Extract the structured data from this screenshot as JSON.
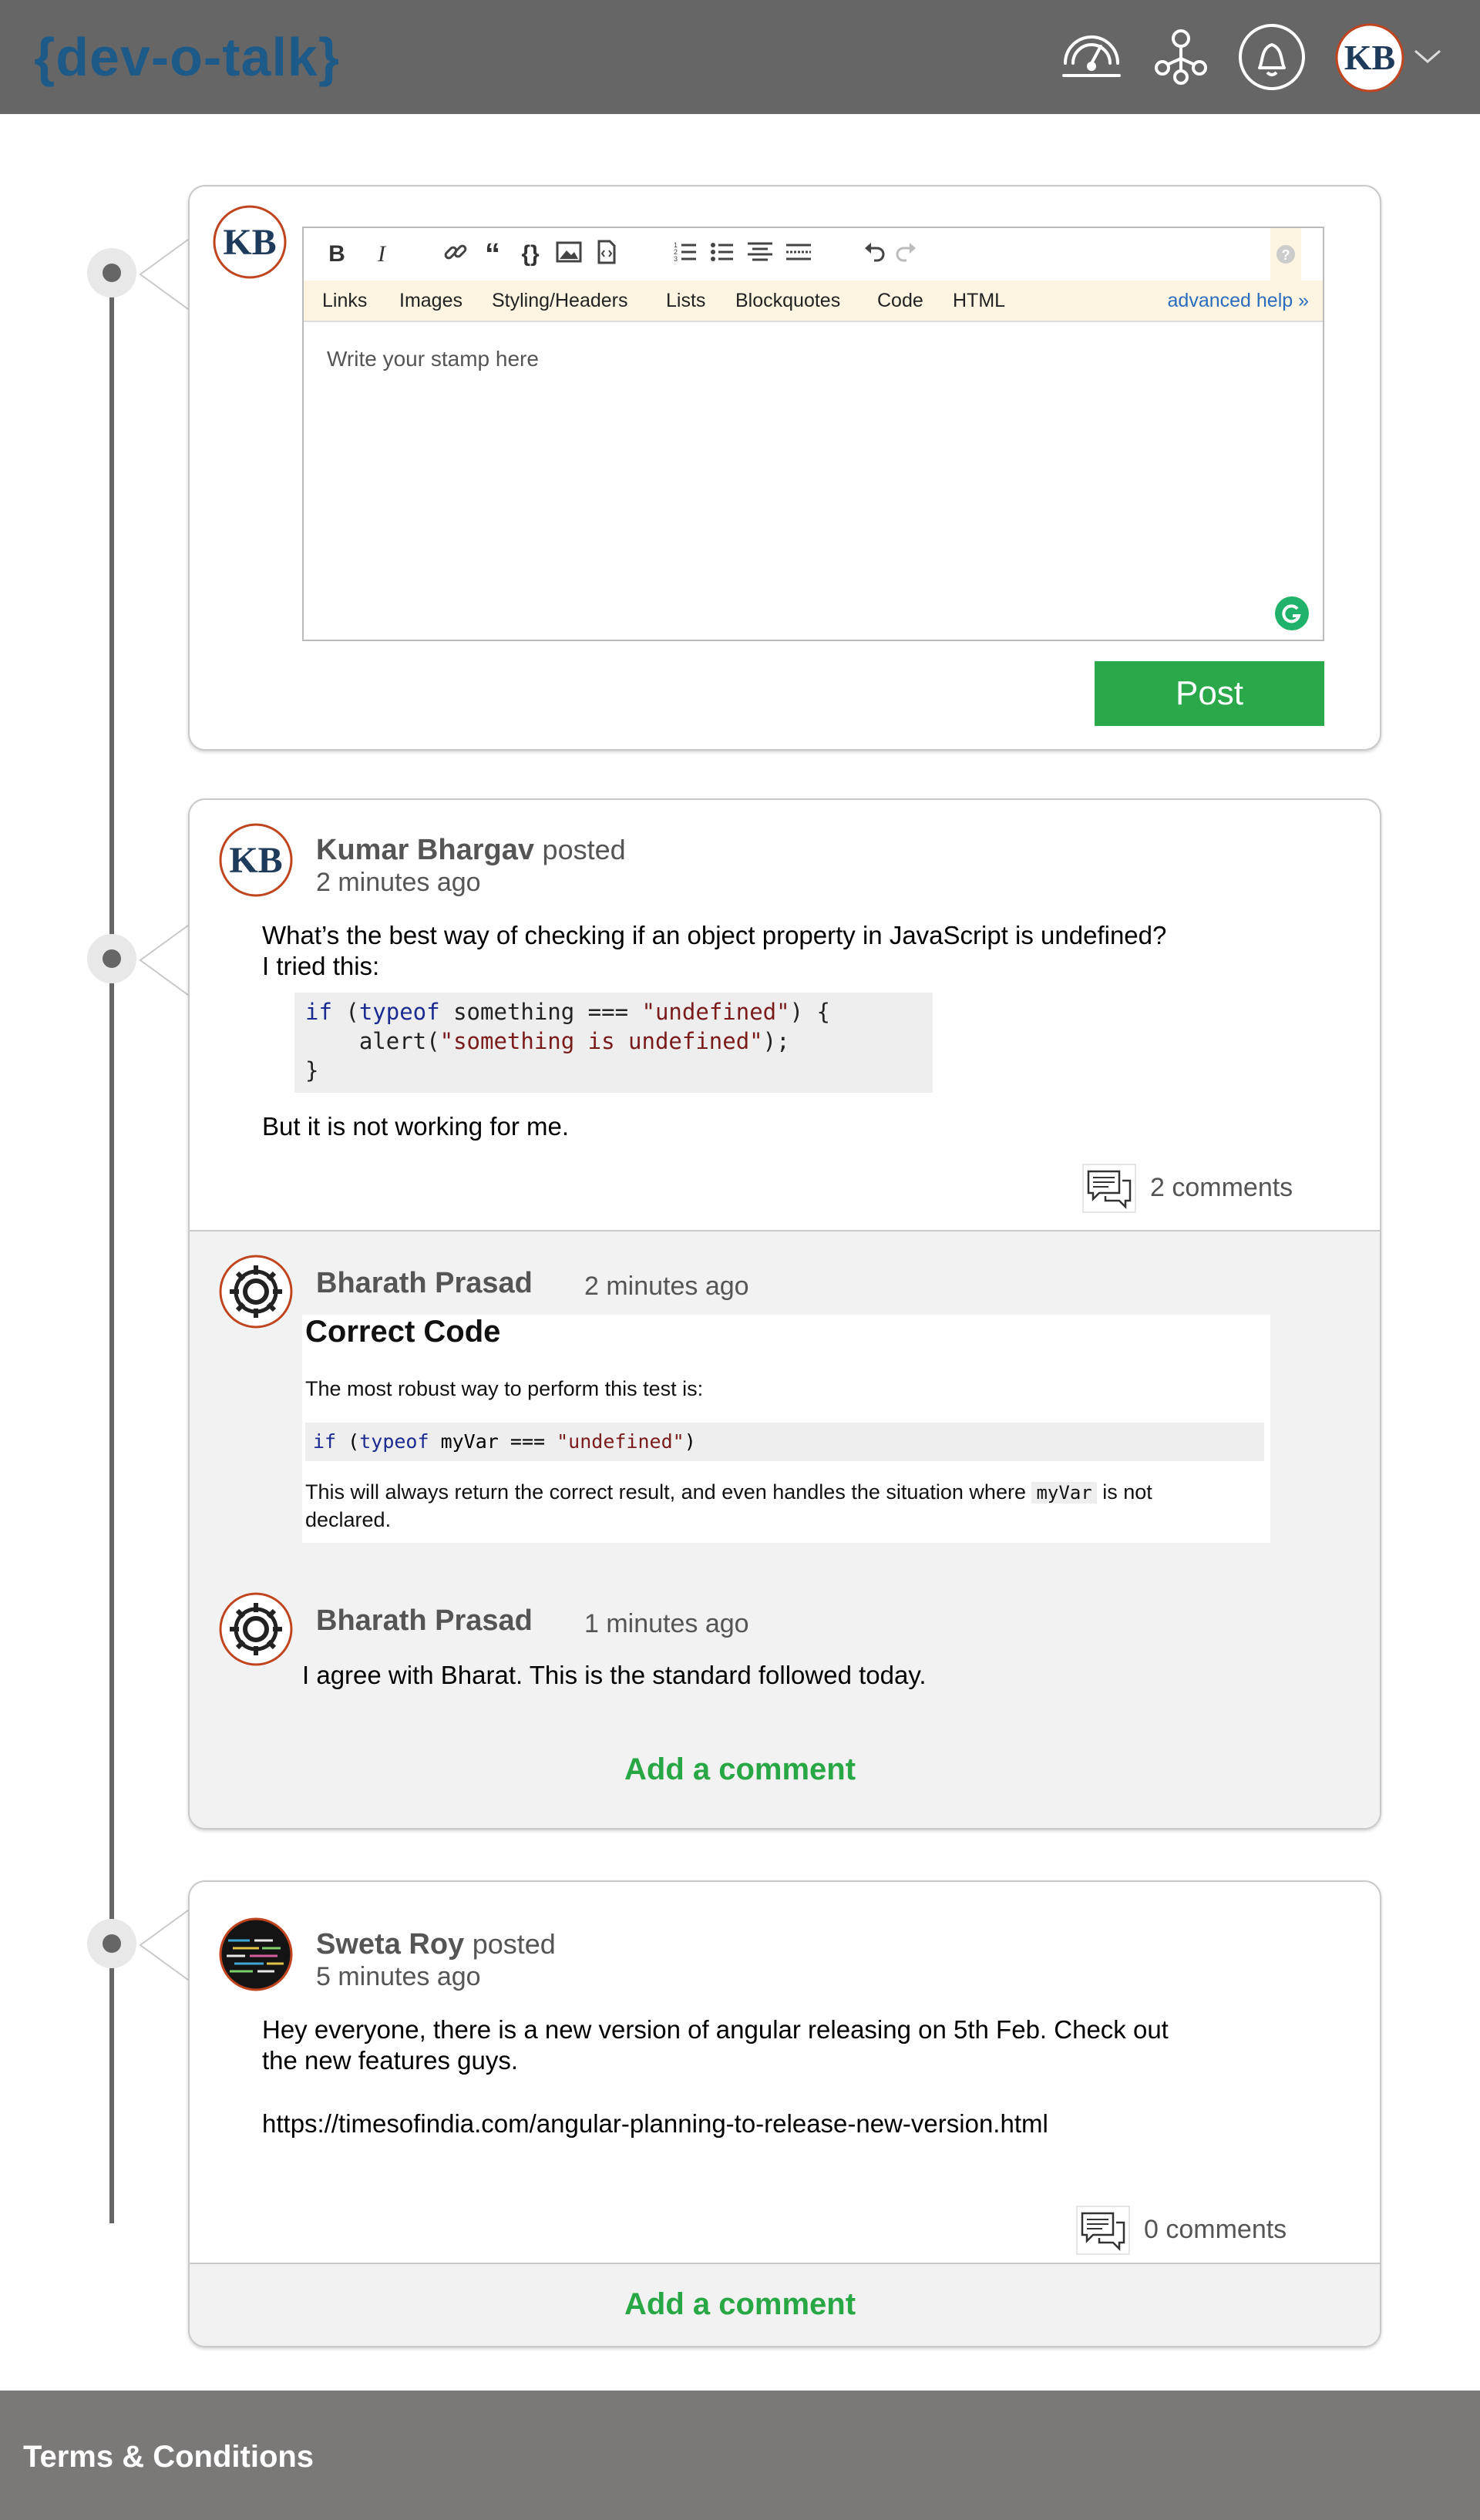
{
  "app": {
    "logo": "{dev-o-talk}"
  },
  "header": {
    "icons": [
      "speedometer-icon",
      "network-icon",
      "bell-icon",
      "avatar",
      "chevron-down-icon"
    ],
    "avatar_initials": "KB"
  },
  "composer": {
    "avatar_initials": "KB",
    "help_links": [
      "Links",
      "Images",
      "Styling/Headers",
      "Lists",
      "Blockquotes",
      "Code",
      "HTML"
    ],
    "advanced_help": "advanced help »",
    "placeholder": "Write your stamp here",
    "post_label": "Post"
  },
  "posts": [
    {
      "author": "Kumar Bhargav",
      "verb": "posted",
      "time": "2 minutes ago",
      "line1": "What’s the best way of checking if an object property in JavaScript is undefined?",
      "line2": "I tried this:",
      "code_l1_kw1": "if",
      "code_l1_a": " (",
      "code_l1_kw2": "typeof",
      "code_l1_b": " something === ",
      "code_l1_str": "\"undefined\"",
      "code_l1_c": ") {",
      "code_l2_a": "    alert(",
      "code_l2_str": "\"something is undefined\"",
      "code_l2_b": ");",
      "code_l3": "}",
      "after": "But it is not working for me.",
      "comments_count": "2 comments",
      "comments": [
        {
          "author": "Bharath Prasad",
          "time": "2 minutes ago",
          "snip_title": "Correct Code",
          "snip_intro": "The most robust way to perform this test is:",
          "snip_code_kw1": "if",
          "snip_code_a": " (",
          "snip_code_kw2": "typeof",
          "snip_code_b": " myVar === ",
          "snip_code_str": "\"undefined\"",
          "snip_code_c": ")",
          "snip_note_a": "This will always return the correct result, and even handles the situation where ",
          "snip_note_code": "myVar",
          "snip_note_b": " is not",
          "snip_note_c": "declared."
        },
        {
          "author": "Bharath Prasad",
          "time": "1 minutes ago",
          "text": "I agree with Bharat. This is the standard followed today."
        }
      ],
      "add_comment": "Add a comment"
    },
    {
      "author": "Sweta Roy",
      "verb": "posted",
      "time": "5 minutes ago",
      "line1": "Hey everyone, there is a new version of angular releasing on 5th Feb. Check out",
      "line2": "the new features guys.",
      "link": "https://timesofindia.com/angular-planning-to-release-new-version.html",
      "comments_count": "0 comments",
      "add_comment": "Add a comment"
    }
  ],
  "footer": {
    "terms": "Terms & Conditions"
  },
  "colors": {
    "header": "#666666",
    "logo": "#1e5a88",
    "accent_green": "#2aa84a",
    "footer": "#7b7878"
  }
}
